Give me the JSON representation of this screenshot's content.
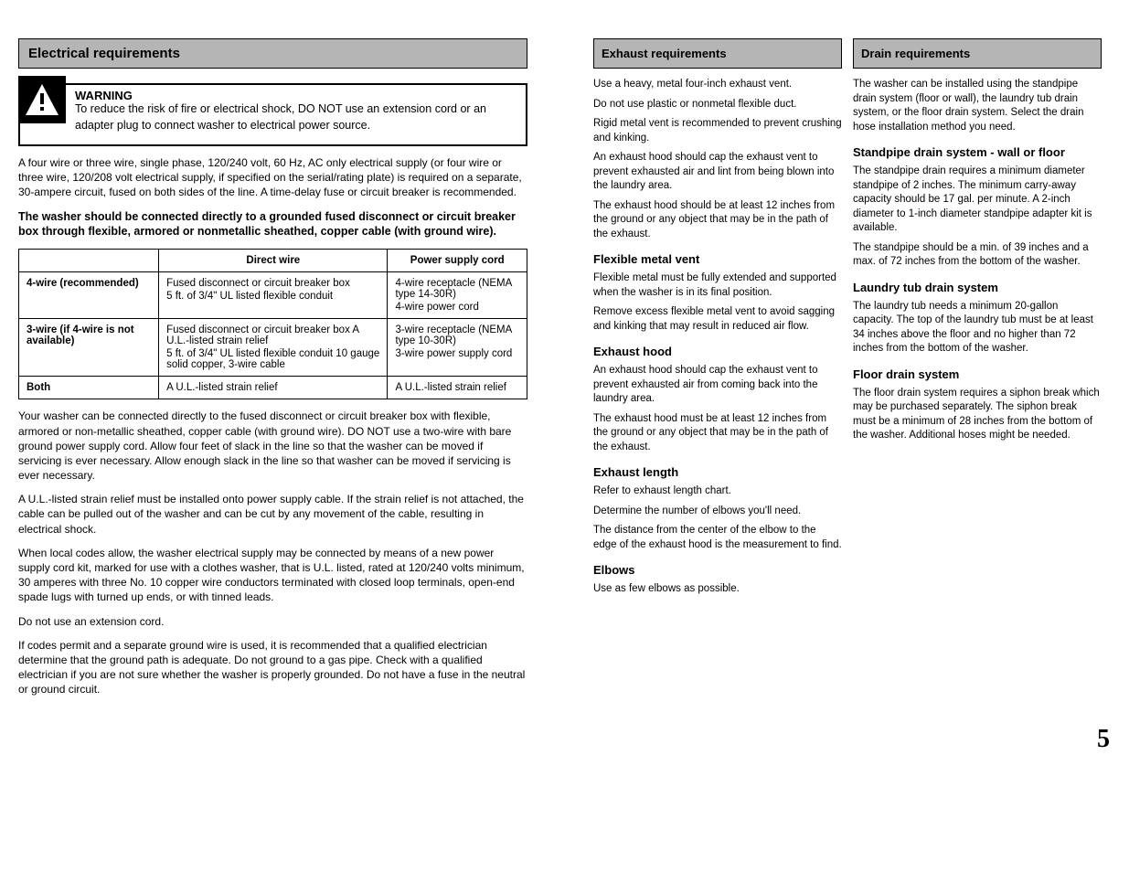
{
  "left": {
    "heading": "Electrical requirements",
    "warning_label": "WARNING",
    "warning_text": "To reduce the risk of fire or electrical shock, DO NOT use an extension cord or an adapter plug to connect washer to electrical power source.",
    "para1": "A four wire or three wire, single phase, 120/240 volt, 60 Hz, AC only electrical supply (or four wire or three wire, 120/208 volt electrical supply, if specified on the serial/rating plate) is required on a separate, 30-ampere circuit, fused on both sides of the line. A time-delay fuse or circuit breaker is recommended.",
    "para2_bold": "The washer should be connected directly to a grounded fused disconnect or circuit breaker box through flexible, armored or nonmetallic sheathed, copper cable (with ground wire).",
    "table": {
      "headers": [
        "",
        "Direct wire",
        "Power supply cord"
      ],
      "rows": [
        {
          "label": "4-wire \n(recommended)",
          "col1": "Fused disconnect or circuit breaker box",
          "col1_sub": "5 ft. of 3/4\" UL listed flexible conduit",
          "col2": "4-wire receptacle \n(NEMA type \n14-30R)",
          "col2_sub": "4-wire power cord"
        },
        {
          "label": "3-wire\n(if 4-wire is not available)",
          "col1": "Fused disconnect or circuit breaker box \nA U.L.-listed strain relief",
          "col1_sub": "5 ft. of 3/4\" UL listed flexible conduit \n10 gauge solid copper, 3-wire cable",
          "col2": "3-wire receptacle (NEMA type 10-30R)",
          "col2_sub": "3-wire power supply cord"
        },
        {
          "label": "Both",
          "col1": "A U.L.-listed strain relief",
          "col2": "A U.L.-listed strain relief"
        }
      ]
    },
    "para3": "Your washer can be connected directly to the fused disconnect or circuit breaker box with flexible, armored or non-metallic sheathed, copper cable (with ground wire). DO NOT use a two-wire with bare ground power supply cord. Allow four feet of slack in the line so that the washer can be moved if servicing is ever necessary. Allow enough slack in the line so that washer can be moved if servicing is ever necessary.",
    "para4": "A U.L.-listed strain relief must be installed onto power supply cable. If the strain relief is not attached, the cable can be pulled out of the washer and can be cut by any movement of the cable, resulting in electrical shock.",
    "para5": "When local codes allow, the washer electrical supply may be connected by means of a new power supply cord kit, marked for use with a clothes washer, that is U.L. listed, rated at 120/240 volts minimum, 30 amperes with three No. 10 copper wire conductors terminated with closed loop terminals, open-end spade lugs with turned up ends, or with tinned leads.",
    "para6": "Do not use an extension cord.",
    "para7": "If codes permit and a separate ground wire is used, it is recommended that a qualified electrician determine that the ground path is adequate. Do not ground to a gas pipe. Check with a qualified electrician if you are not sure whether the washer is properly grounded. Do not have a fuse in the neutral or ground circuit."
  },
  "mid": {
    "heading": "Exhaust requirements",
    "p1": "Use a heavy, metal four-inch exhaust vent.",
    "p2": "Do not use plastic or nonmetal flexible duct.",
    "p3": "Rigid metal vent is recommended to prevent crushing and kinking.",
    "p4": "An exhaust hood should cap the exhaust vent to prevent exhausted air and lint from being blown into the laundry area.",
    "p5": "The exhaust hood should be at least 12 inches from the ground or any object that may be in the path of the exhaust.",
    "sub1": "Flexible metal vent",
    "sub1_p1": "Flexible metal must be fully extended and supported when the washer is in its final position.",
    "sub1_p2": "Remove excess flexible metal vent to avoid sagging and kinking that may result in reduced air flow.",
    "sub2": "Exhaust hood",
    "sub2_p1": "An exhaust hood should cap the exhaust vent to prevent exhausted air from coming back into the laundry area.",
    "sub2_p2": "The exhaust hood must be at least 12 inches from the ground or any object that may be in the path of the exhaust.",
    "sub3": "Exhaust length",
    "sub3_p1": "Refer to exhaust length chart.",
    "sub3_p2": "Determine the number of elbows you'll need.",
    "sub3_p3": "The distance from the center of the elbow to the edge of the exhaust hood is the measurement to find.",
    "sub4": "Elbows",
    "sub4_p1": "Use as few elbows as possible."
  },
  "right": {
    "heading": "Drain requirements",
    "p1": "The washer can be installed using the standpipe drain system (floor or wall), the laundry tub drain system, or the floor drain system. Select the drain hose installation method you need.",
    "sub1": "Standpipe drain system - wall or floor",
    "sub1_p1": "The standpipe drain requires a minimum diameter standpipe of 2 inches. The minimum carry-away capacity should be 17 gal. per minute. A 2-inch diameter to 1-inch diameter standpipe adapter kit is available.",
    "sub1_p2": "The standpipe should be a min. of 39 inches and a max. of 72 inches from the bottom of the washer.",
    "sub2": "Laundry tub drain system",
    "sub2_p1": "The laundry tub needs a minimum 20-gallon capacity. The top of the laundry tub must be at least 34 inches above the floor and no higher than 72 inches from the bottom of the washer.",
    "sub3": "Floor drain system",
    "sub3_p1": "The floor drain system requires a siphon break which may be purchased separately. The siphon break must be a minimum of 28 inches from the bottom of the washer. Additional hoses might be needed."
  },
  "footer": "5"
}
